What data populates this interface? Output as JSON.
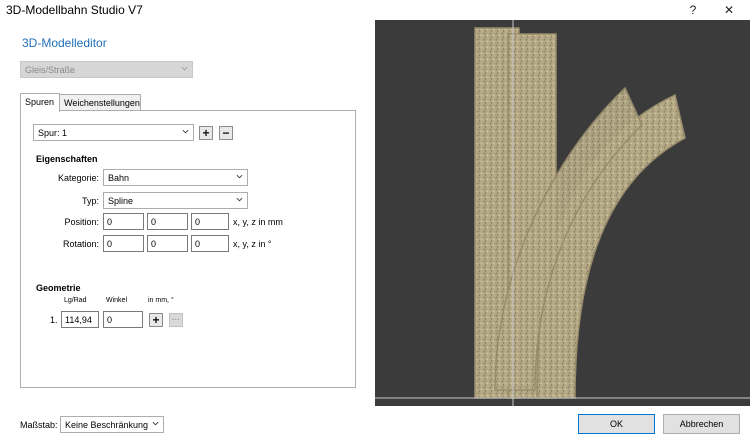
{
  "window": {
    "title": "3D-Modellbahn Studio V7",
    "help_glyph": "?",
    "close_glyph": "✕"
  },
  "editor": {
    "heading": "3D-Modelleditor",
    "type_select": "Gleis/Straße"
  },
  "tabs": [
    {
      "label": "Spuren"
    },
    {
      "label": "Weichenstellungen"
    }
  ],
  "spur": {
    "select": "Spur: 1",
    "add": "+",
    "remove": "−"
  },
  "eigenschaften": {
    "title": "Eigenschaften",
    "kategorie_label": "Kategorie:",
    "kategorie_value": "Bahn",
    "typ_label": "Typ:",
    "typ_value": "Spline",
    "position_label": "Position:",
    "position": [
      "0",
      "0",
      "0"
    ],
    "position_unit": "x, y, z in mm",
    "rotation_label": "Rotation:",
    "rotation": [
      "0",
      "0",
      "0"
    ],
    "rotation_unit": "x, y, z in °"
  },
  "geometrie": {
    "title": "Geometrie",
    "col_lgrad": "Lg/Rad",
    "col_winkel": "Winkel",
    "col_units": "in mm, °",
    "rows": [
      {
        "index": "1.",
        "lgrad": "114,94",
        "winkel": "0"
      }
    ],
    "add": "+",
    "remove": "···"
  },
  "footer": {
    "massstab_label": "Maßstab:",
    "massstab_value": "Keine Beschränkung",
    "ok": "OK",
    "cancel": "Abbrechen"
  },
  "colors": {
    "accent": "#1e6fb8",
    "viewport_bg": "#3b3b3b",
    "track": "#b9ad8c"
  }
}
